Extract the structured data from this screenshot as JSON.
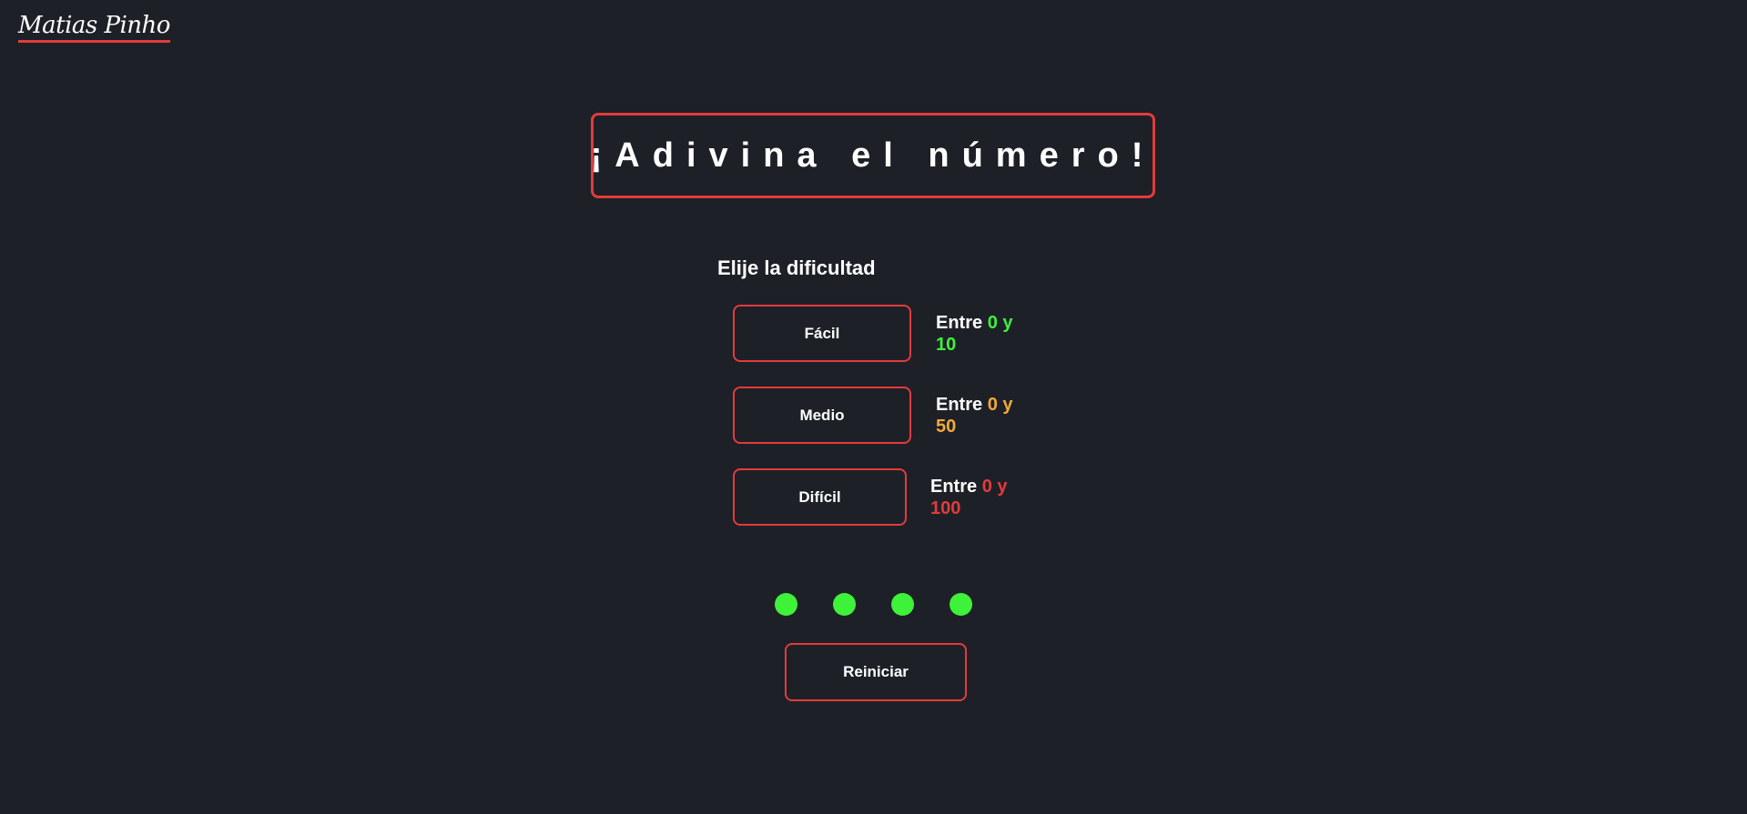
{
  "header": {
    "logo_text": "Matias Pinho"
  },
  "main": {
    "title": "¡Adivina el número!",
    "subtitle": "Elije la dificultad",
    "difficulties": [
      {
        "label": "Fácil",
        "range_prefix": "Entre",
        "range_mid": "0 y",
        "range_max": "10",
        "color": "#3ef23a"
      },
      {
        "label": "Medio",
        "range_prefix": "Entre",
        "range_mid": "0 y",
        "range_max": "50",
        "color": "#f2a93a"
      },
      {
        "label": "Difícil",
        "range_prefix": "Entre",
        "range_mid": "0 y",
        "range_max": "100",
        "color": "#e23b3b"
      }
    ],
    "lives": {
      "count": 4,
      "color": "#3ef23a"
    },
    "restart_label": "Reiniciar"
  },
  "theme": {
    "background": "#1e2028",
    "accent": "#e23b3b"
  }
}
